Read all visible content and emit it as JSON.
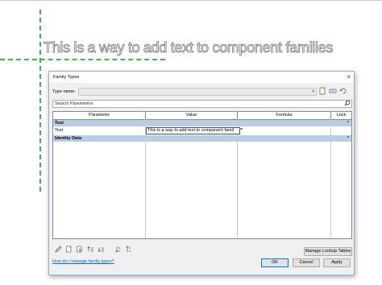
{
  "canvas": {
    "text": "This is a way to add text to component families"
  },
  "dialog": {
    "title": "Family Types",
    "close_glyph": "×",
    "type_name_label": "Type name:",
    "type_name_value": "",
    "search_placeholder": "Search Parameters",
    "columns": [
      "Parameter",
      "Value",
      "Formula",
      "Lock"
    ],
    "groups": [
      {
        "name": "Text",
        "rows": [
          {
            "parameter": "Text",
            "value": "This is a way to add text to component famil",
            "formula": "="
          }
        ]
      },
      {
        "name": "Identity Data",
        "rows": []
      }
    ],
    "manage_lookup_label": "Manage Lookup Tables",
    "help_link": "How do I manage family types?",
    "ok_label": "OK",
    "cancel_label": "Cancel",
    "apply_label": "Apply"
  },
  "icons": {
    "new_type": "new-type-icon",
    "rename_type": "rename-type-icon",
    "delete_type": "delete-type-icon",
    "search": "search-icon",
    "edit": "pencil-icon"
  },
  "colors": {
    "guide": "#3cb84a",
    "group_header": "#b9cde3",
    "link": "#0066cc"
  }
}
